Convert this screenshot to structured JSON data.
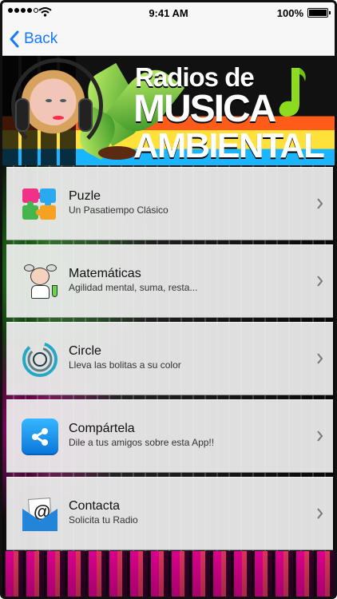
{
  "status_bar": {
    "time": "9:41 AM",
    "battery": "100%"
  },
  "navigation": {
    "back_label": "Back"
  },
  "banner": {
    "title_small": "Radios de",
    "title_big": "MUSICA",
    "title_big2": "AMBIENTAL"
  },
  "menu": {
    "items": [
      {
        "title": "Puzle",
        "subtitle": "Un Pasatiempo Clásico",
        "icon": "puzzle-icon"
      },
      {
        "title": "Matemáticas",
        "subtitle": "Agilidad mental, suma, resta...",
        "icon": "scientist-icon"
      },
      {
        "title": "Circle",
        "subtitle": "Lleva las bolitas a su color",
        "icon": "circle-icon"
      },
      {
        "title": "Compártela",
        "subtitle": "Dile a tus amigos sobre esta App!!",
        "icon": "share-icon"
      },
      {
        "title": "Contacta",
        "subtitle": "Solicita tu Radio",
        "icon": "mail-icon"
      }
    ]
  },
  "colors": {
    "ios_blue": "#1479ff",
    "list_background": "#ececec",
    "share_blue": "#1496f1",
    "mail_blue": "#2385d9"
  }
}
